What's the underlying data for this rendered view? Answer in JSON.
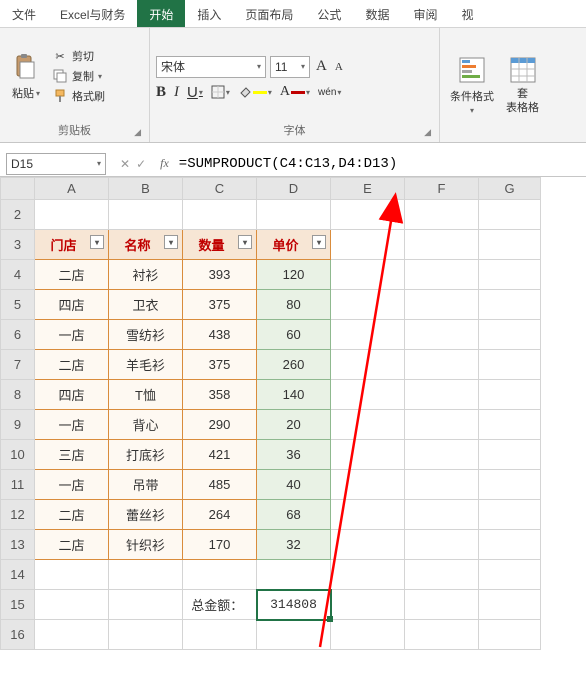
{
  "tabs": [
    "文件",
    "Excel与财务",
    "开始",
    "插入",
    "页面布局",
    "公式",
    "数据",
    "审阅",
    "视"
  ],
  "active_tab_index": 2,
  "ribbon": {
    "clipboard": {
      "paste": "粘贴",
      "cut": "剪切",
      "copy": "复制",
      "painter": "格式刷",
      "group_label": "剪贴板"
    },
    "font": {
      "name": "宋体",
      "size": "11",
      "bigger_label": "A",
      "smaller_label": "A",
      "bold": "B",
      "italic": "I",
      "underline": "U",
      "wen": "wén",
      "group_label": "字体"
    },
    "styles": {
      "cond_format": "条件格式",
      "table_format_top": "套",
      "table_format_bottom": "表格格"
    }
  },
  "namebox": "D15",
  "formula": "=SUMPRODUCT(C4:C13,D4:D13)",
  "columns": [
    "A",
    "B",
    "C",
    "D",
    "E",
    "F",
    "G"
  ],
  "row_labels": [
    "2",
    "3",
    "4",
    "5",
    "6",
    "7",
    "8",
    "9",
    "10",
    "11",
    "12",
    "13",
    "14",
    "15",
    "16"
  ],
  "headers": [
    "门店",
    "名称",
    "数量",
    "单价"
  ],
  "rows": [
    {
      "a": "二店",
      "b": "衬衫",
      "c": "393",
      "d": "120"
    },
    {
      "a": "四店",
      "b": "卫衣",
      "c": "375",
      "d": "80"
    },
    {
      "a": "一店",
      "b": "雪纺衫",
      "c": "438",
      "d": "60"
    },
    {
      "a": "二店",
      "b": "羊毛衫",
      "c": "375",
      "d": "260"
    },
    {
      "a": "四店",
      "b": "T恤",
      "c": "358",
      "d": "140"
    },
    {
      "a": "一店",
      "b": "背心",
      "c": "290",
      "d": "20"
    },
    {
      "a": "三店",
      "b": "打底衫",
      "c": "421",
      "d": "36"
    },
    {
      "a": "一店",
      "b": "吊带",
      "c": "485",
      "d": "40"
    },
    {
      "a": "二店",
      "b": "蕾丝衫",
      "c": "264",
      "d": "68"
    },
    {
      "a": "二店",
      "b": "针织衫",
      "c": "170",
      "d": "32"
    }
  ],
  "total_label": "总金额：",
  "total_value": "314808"
}
